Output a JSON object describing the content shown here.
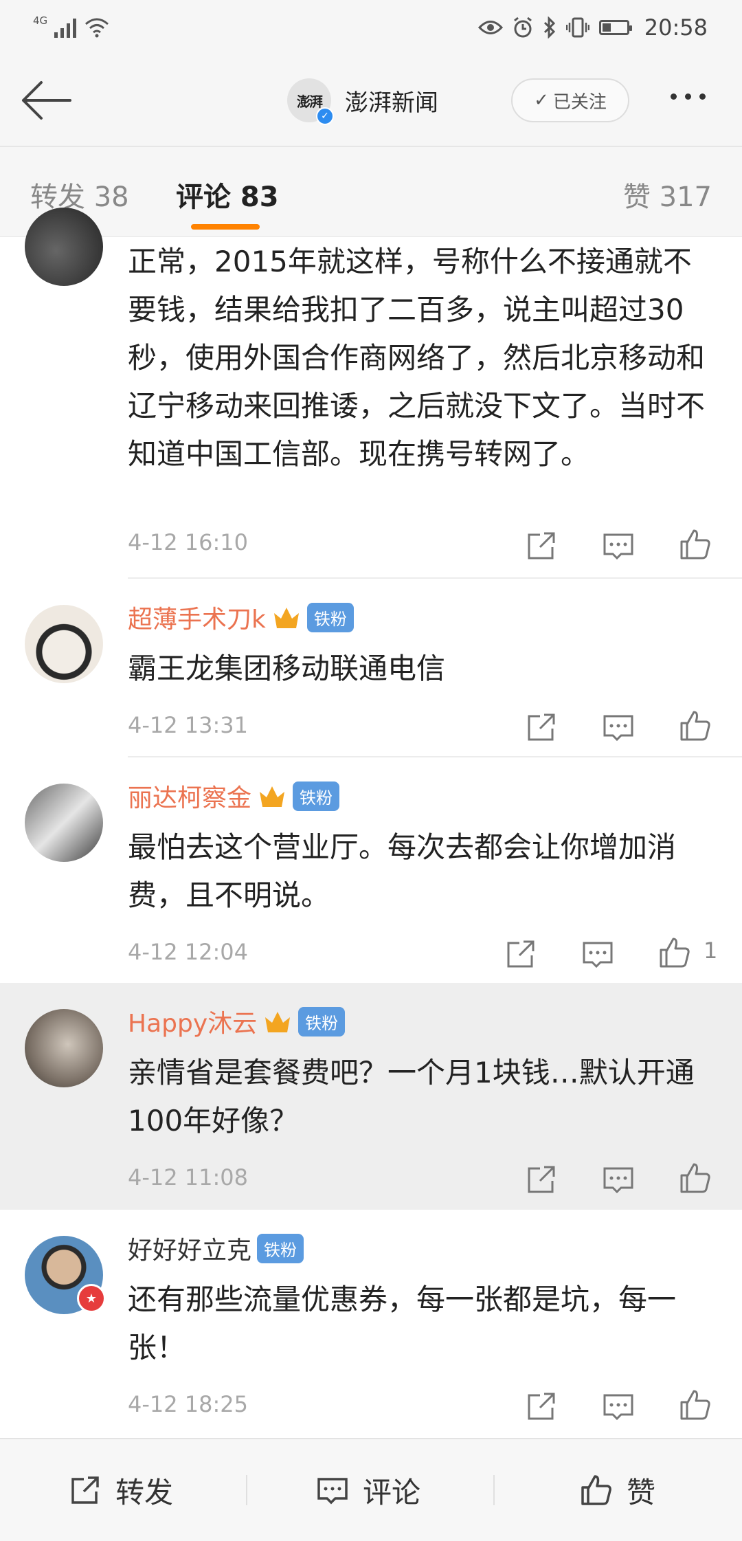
{
  "status_bar": {
    "network": "4G",
    "time": "20:58",
    "battery_level": 0.35
  },
  "header": {
    "account_name": "澎湃新闻",
    "avatar_text": "澎湃",
    "follow_label": "已关注"
  },
  "tabs": [
    {
      "label": "转发 38"
    },
    {
      "label": "评论 83"
    },
    {
      "label": "赞 317"
    }
  ],
  "comments": [
    {
      "text": "正常，2015年就这样，号称什么不接通就不要钱，结果给我扣了二百多，说主叫超过30秒，使用外国合作商网络了，然后北京移动和辽宁移动来回推诿，之后就没下文了。当时不知道中国工信部。现在携号转网了。",
      "time": "4-12 16:10"
    },
    {
      "user": "超薄手术刀k",
      "badge": "铁粉",
      "text": "霸王龙集团移动联通电信",
      "time": "4-12 13:31"
    },
    {
      "user": "丽达柯察金",
      "badge": "铁粉",
      "text": "最怕去这个营业厅。每次去都会让你增加消费，且不明说。",
      "time": "4-12 12:04",
      "likes": "1"
    },
    {
      "user": "Happy沐云",
      "badge": "铁粉",
      "text": "亲情省是套餐费吧？一个月1块钱…默认开通100年好像？",
      "time": "4-12 11:08"
    },
    {
      "user": "好好好立克",
      "badge": "铁粉",
      "text": "还有那些流量优惠券，每一张都是坑，每一张！",
      "time": "4-12 18:25"
    }
  ],
  "bottom_bar": {
    "repost": "转发",
    "comment": "评论",
    "like": "赞"
  },
  "colors": {
    "accent": "#ff8200",
    "username": "#eb7350",
    "badge": "#5b9be0"
  }
}
